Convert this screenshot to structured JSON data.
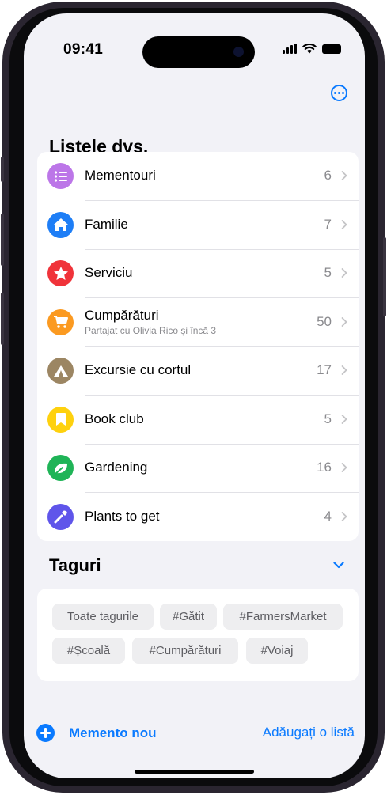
{
  "status_bar": {
    "time": "09:41"
  },
  "colors": {
    "accent": "#0a7aff",
    "background": "#f2f2f7"
  },
  "header": {
    "more_icon": "ellipsis-circle-icon"
  },
  "lists_section": {
    "title": "Listele dvs."
  },
  "lists": [
    {
      "name": "Mementouri",
      "count": "6",
      "color": "#bc76e8",
      "icon": "list-bullet-icon"
    },
    {
      "name": "Familie",
      "count": "7",
      "color": "#1e7ef6",
      "icon": "house-icon"
    },
    {
      "name": "Serviciu",
      "count": "5",
      "color": "#f0333a",
      "icon": "star-icon"
    },
    {
      "name": "Cumpărături",
      "subtitle": "Partajat cu Olivia Rico și încă 3",
      "count": "50",
      "color": "#fb9a21",
      "icon": "cart-icon"
    },
    {
      "name": "Excursie cu cortul",
      "count": "17",
      "color": "#9c8663",
      "icon": "tent-icon"
    },
    {
      "name": "Book club",
      "count": "5",
      "color": "#fed10e",
      "icon": "bookmark-icon"
    },
    {
      "name": "Gardening",
      "count": "16",
      "color": "#1fb457",
      "icon": "leaf-icon"
    },
    {
      "name": "Plants to get",
      "count": "4",
      "color": "#5f55ea",
      "icon": "dropper-icon"
    }
  ],
  "tags_section": {
    "title": "Taguri"
  },
  "tags": [
    "Toate tagurile",
    "#Gătit",
    "#FarmersMarket",
    "#Școală",
    "#Cumpărături",
    "#Voiaj"
  ],
  "footer": {
    "new_reminder": "Memento nou",
    "add_list": "Adăugați o listă"
  }
}
